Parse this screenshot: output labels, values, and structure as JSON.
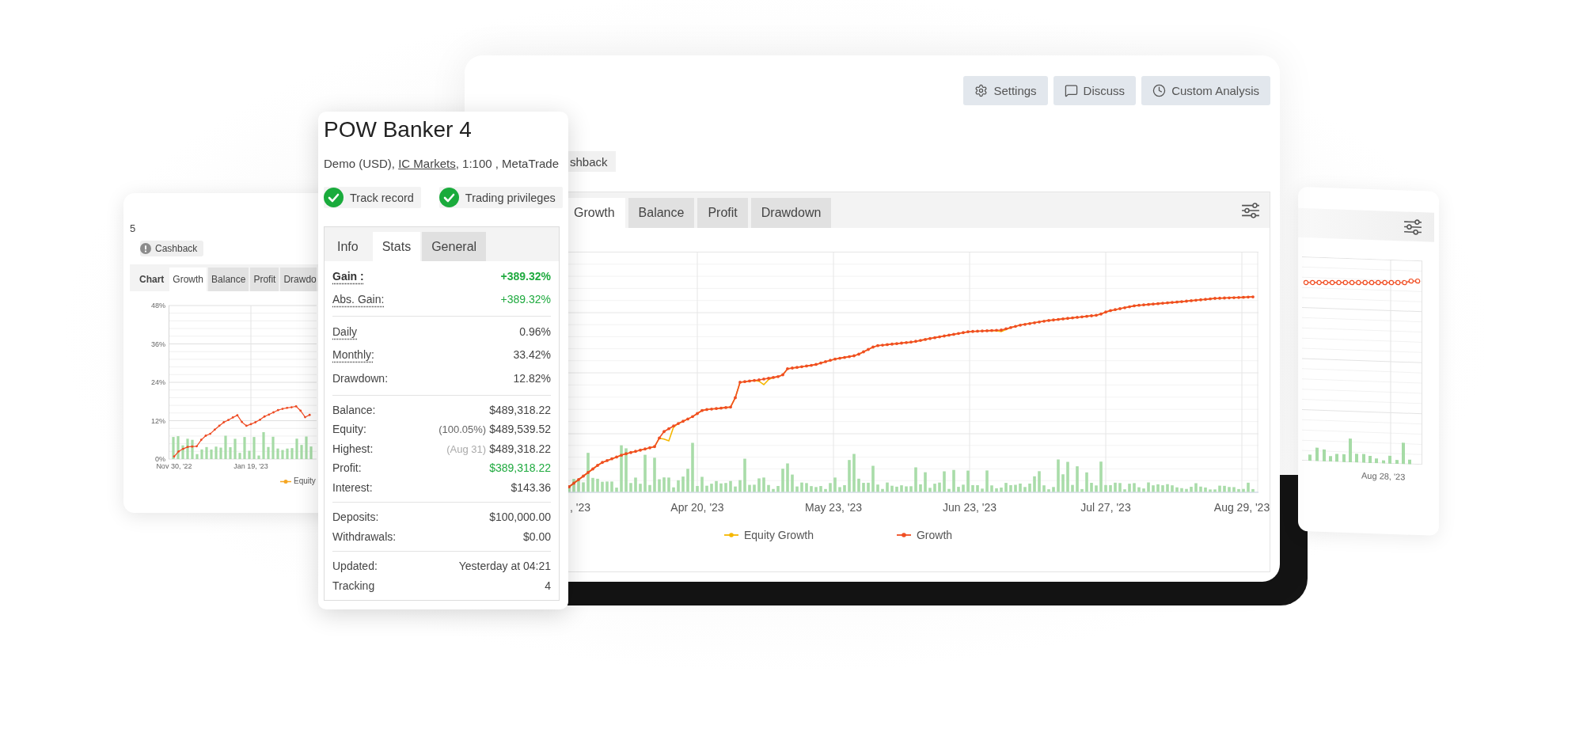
{
  "left_preview": {
    "heading": "5",
    "cashback_tag": "Cashback",
    "chart_label": "Chart",
    "tabs": [
      {
        "label": "Growth",
        "selected": true
      },
      {
        "label": "Balance",
        "selected": false
      },
      {
        "label": "Profit",
        "selected": false
      },
      {
        "label": "Drawdo",
        "selected": false
      }
    ],
    "chart_data": {
      "type": "line",
      "grid": true,
      "categories": [
        "Nov 30, '22",
        null,
        null,
        null,
        null,
        null,
        null,
        null,
        null,
        null,
        null,
        null,
        null,
        null,
        null,
        null,
        null,
        "Jan 19, '23",
        null,
        null,
        null,
        null,
        null,
        null,
        null,
        null,
        null,
        null,
        null,
        null,
        null
      ],
      "ylim": [
        0,
        48
      ],
      "yticks": [
        {
          "value": 48,
          "label": "48%"
        },
        {
          "value": 36,
          "label": "36%"
        },
        {
          "value": 24,
          "label": "24%"
        },
        {
          "value": 12,
          "label": "12%"
        },
        {
          "value": 0,
          "label": "0%"
        }
      ],
      "series": [
        {
          "color": "#ee4a22",
          "values": [
            0.8,
            2.4,
            3.2,
            3.8,
            3.9,
            4.0,
            6.0,
            7.3,
            7.9,
            9.2,
            10.4,
            11.5,
            12.2,
            13.0,
            13.7,
            11.6,
            10.4,
            10.9,
            11.5,
            12.3,
            13.3,
            13.9,
            14.6,
            15.3,
            15.7,
            16.0,
            16.2,
            16.5,
            15.1,
            13.1,
            13.8
          ]
        }
      ]
    },
    "legend": [
      "Equity"
    ]
  },
  "stats_card": {
    "title": "POW Banker 4",
    "subtitle": {
      "before": "Demo (USD), ",
      "link": "IC Markets",
      "after": ", 1:100 , MetaTrade"
    },
    "badges": [
      {
        "label": "Track record",
        "verified": true
      },
      {
        "label": "Trading privileges",
        "verified": true
      }
    ],
    "tabs": [
      {
        "label": "Info",
        "kind": "plain",
        "selected": false
      },
      {
        "label": "Stats",
        "kind": "tab",
        "selected": true
      },
      {
        "label": "General",
        "kind": "tab",
        "selected": false
      }
    ],
    "sections": [
      {
        "rows": [
          {
            "label": "Gain :",
            "value": "+389.32%",
            "dotted": true,
            "bold": true,
            "positive": true
          },
          {
            "label": "Abs. Gain:",
            "value": "+389.32%",
            "dotted": true,
            "bold": false,
            "positive": true
          }
        ]
      },
      {
        "rows": [
          {
            "label": "Daily",
            "value": "0.96%",
            "dotted": true,
            "bold": false,
            "positive": false
          },
          {
            "label": "Monthly:",
            "value": "33.42%",
            "dotted": true,
            "bold": false,
            "positive": false
          },
          {
            "label": "Drawdown:",
            "value": "12.82%",
            "dotted": false,
            "bold": false,
            "positive": false
          }
        ]
      },
      {
        "rows": [
          {
            "label": "Balance:",
            "value": "$489,318.22",
            "dotted": false,
            "bold": false,
            "positive": false
          },
          {
            "label": "Equity:",
            "note": {
              "text": "(100.05%)",
              "faded": false
            },
            "value": "$489,539.52",
            "dotted": false,
            "bold": false,
            "positive": false
          },
          {
            "label": "Highest:",
            "note": {
              "text": "(Aug 31)",
              "faded": true
            },
            "value": "$489,318.22",
            "dotted": false,
            "bold": false,
            "positive": false
          },
          {
            "label": "Profit:",
            "value": "$389,318.22",
            "dotted": false,
            "bold": false,
            "positive": true
          },
          {
            "label": "Interest:",
            "value": "$143.36",
            "dotted": false,
            "bold": false,
            "positive": false
          }
        ]
      },
      {
        "rows": [
          {
            "label": "Deposits:",
            "value": "$100,000.00",
            "dotted": false,
            "bold": false,
            "positive": false
          },
          {
            "label": "Withdrawals:",
            "value": "$0.00",
            "dotted": false,
            "bold": false,
            "positive": false
          }
        ]
      },
      {
        "rows": [
          {
            "label": "Updated:",
            "value": "Yesterday at 04:21",
            "dotted": false,
            "bold": false,
            "positive": false
          },
          {
            "label": "Tracking",
            "value": "4",
            "dotted": false,
            "bold": false,
            "positive": false
          }
        ]
      }
    ]
  },
  "main_card": {
    "actions": [
      "Settings",
      "Discuss",
      "Custom Analysis"
    ],
    "cashback_tag": "shback",
    "chart": {
      "tabs": [
        {
          "label": "Growth",
          "selected": true
        },
        {
          "label": "Balance",
          "selected": false
        },
        {
          "label": "Profit",
          "selected": false
        },
        {
          "label": "Drawdown",
          "selected": false
        }
      ],
      "x_labels": [
        ", '23",
        "Apr 20, '23",
        "May 23, '23",
        "Jun 23, '23",
        "Jul 27, '23",
        "Aug 29, '23"
      ],
      "legend": [
        {
          "label": "Equity Growth",
          "color": "#f5b700"
        },
        {
          "label": "Growth",
          "color": "#f04e23"
        }
      ]
    }
  },
  "right_preview": {
    "x_labels": [
      "Aug 28, '23"
    ]
  }
}
